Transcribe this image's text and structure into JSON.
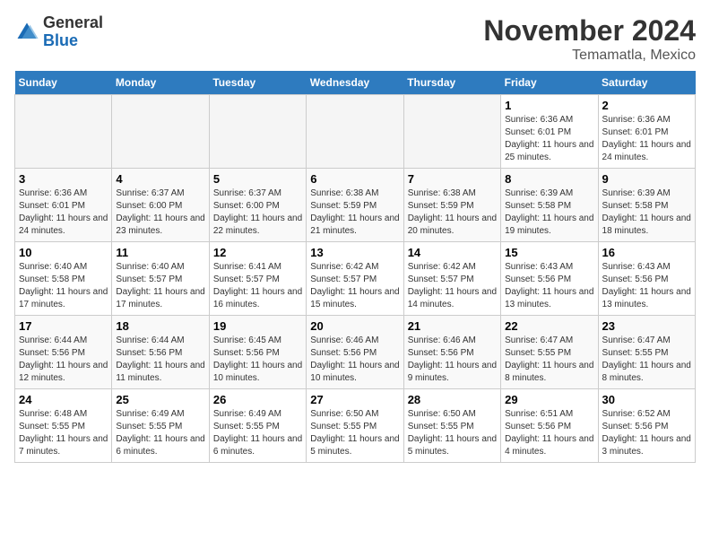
{
  "header": {
    "logo_general": "General",
    "logo_blue": "Blue",
    "month_title": "November 2024",
    "location": "Temamatla, Mexico"
  },
  "weekdays": [
    "Sunday",
    "Monday",
    "Tuesday",
    "Wednesday",
    "Thursday",
    "Friday",
    "Saturday"
  ],
  "weeks": [
    [
      {
        "day": "",
        "empty": true
      },
      {
        "day": "",
        "empty": true
      },
      {
        "day": "",
        "empty": true
      },
      {
        "day": "",
        "empty": true
      },
      {
        "day": "",
        "empty": true
      },
      {
        "day": "1",
        "sunrise": "Sunrise: 6:36 AM",
        "sunset": "Sunset: 6:01 PM",
        "daylight": "Daylight: 11 hours and 25 minutes."
      },
      {
        "day": "2",
        "sunrise": "Sunrise: 6:36 AM",
        "sunset": "Sunset: 6:01 PM",
        "daylight": "Daylight: 11 hours and 24 minutes."
      }
    ],
    [
      {
        "day": "3",
        "sunrise": "Sunrise: 6:36 AM",
        "sunset": "Sunset: 6:01 PM",
        "daylight": "Daylight: 11 hours and 24 minutes."
      },
      {
        "day": "4",
        "sunrise": "Sunrise: 6:37 AM",
        "sunset": "Sunset: 6:00 PM",
        "daylight": "Daylight: 11 hours and 23 minutes."
      },
      {
        "day": "5",
        "sunrise": "Sunrise: 6:37 AM",
        "sunset": "Sunset: 6:00 PM",
        "daylight": "Daylight: 11 hours and 22 minutes."
      },
      {
        "day": "6",
        "sunrise": "Sunrise: 6:38 AM",
        "sunset": "Sunset: 5:59 PM",
        "daylight": "Daylight: 11 hours and 21 minutes."
      },
      {
        "day": "7",
        "sunrise": "Sunrise: 6:38 AM",
        "sunset": "Sunset: 5:59 PM",
        "daylight": "Daylight: 11 hours and 20 minutes."
      },
      {
        "day": "8",
        "sunrise": "Sunrise: 6:39 AM",
        "sunset": "Sunset: 5:58 PM",
        "daylight": "Daylight: 11 hours and 19 minutes."
      },
      {
        "day": "9",
        "sunrise": "Sunrise: 6:39 AM",
        "sunset": "Sunset: 5:58 PM",
        "daylight": "Daylight: 11 hours and 18 minutes."
      }
    ],
    [
      {
        "day": "10",
        "sunrise": "Sunrise: 6:40 AM",
        "sunset": "Sunset: 5:58 PM",
        "daylight": "Daylight: 11 hours and 17 minutes."
      },
      {
        "day": "11",
        "sunrise": "Sunrise: 6:40 AM",
        "sunset": "Sunset: 5:57 PM",
        "daylight": "Daylight: 11 hours and 17 minutes."
      },
      {
        "day": "12",
        "sunrise": "Sunrise: 6:41 AM",
        "sunset": "Sunset: 5:57 PM",
        "daylight": "Daylight: 11 hours and 16 minutes."
      },
      {
        "day": "13",
        "sunrise": "Sunrise: 6:42 AM",
        "sunset": "Sunset: 5:57 PM",
        "daylight": "Daylight: 11 hours and 15 minutes."
      },
      {
        "day": "14",
        "sunrise": "Sunrise: 6:42 AM",
        "sunset": "Sunset: 5:57 PM",
        "daylight": "Daylight: 11 hours and 14 minutes."
      },
      {
        "day": "15",
        "sunrise": "Sunrise: 6:43 AM",
        "sunset": "Sunset: 5:56 PM",
        "daylight": "Daylight: 11 hours and 13 minutes."
      },
      {
        "day": "16",
        "sunrise": "Sunrise: 6:43 AM",
        "sunset": "Sunset: 5:56 PM",
        "daylight": "Daylight: 11 hours and 13 minutes."
      }
    ],
    [
      {
        "day": "17",
        "sunrise": "Sunrise: 6:44 AM",
        "sunset": "Sunset: 5:56 PM",
        "daylight": "Daylight: 11 hours and 12 minutes."
      },
      {
        "day": "18",
        "sunrise": "Sunrise: 6:44 AM",
        "sunset": "Sunset: 5:56 PM",
        "daylight": "Daylight: 11 hours and 11 minutes."
      },
      {
        "day": "19",
        "sunrise": "Sunrise: 6:45 AM",
        "sunset": "Sunset: 5:56 PM",
        "daylight": "Daylight: 11 hours and 10 minutes."
      },
      {
        "day": "20",
        "sunrise": "Sunrise: 6:46 AM",
        "sunset": "Sunset: 5:56 PM",
        "daylight": "Daylight: 11 hours and 10 minutes."
      },
      {
        "day": "21",
        "sunrise": "Sunrise: 6:46 AM",
        "sunset": "Sunset: 5:56 PM",
        "daylight": "Daylight: 11 hours and 9 minutes."
      },
      {
        "day": "22",
        "sunrise": "Sunrise: 6:47 AM",
        "sunset": "Sunset: 5:55 PM",
        "daylight": "Daylight: 11 hours and 8 minutes."
      },
      {
        "day": "23",
        "sunrise": "Sunrise: 6:47 AM",
        "sunset": "Sunset: 5:55 PM",
        "daylight": "Daylight: 11 hours and 8 minutes."
      }
    ],
    [
      {
        "day": "24",
        "sunrise": "Sunrise: 6:48 AM",
        "sunset": "Sunset: 5:55 PM",
        "daylight": "Daylight: 11 hours and 7 minutes."
      },
      {
        "day": "25",
        "sunrise": "Sunrise: 6:49 AM",
        "sunset": "Sunset: 5:55 PM",
        "daylight": "Daylight: 11 hours and 6 minutes."
      },
      {
        "day": "26",
        "sunrise": "Sunrise: 6:49 AM",
        "sunset": "Sunset: 5:55 PM",
        "daylight": "Daylight: 11 hours and 6 minutes."
      },
      {
        "day": "27",
        "sunrise": "Sunrise: 6:50 AM",
        "sunset": "Sunset: 5:55 PM",
        "daylight": "Daylight: 11 hours and 5 minutes."
      },
      {
        "day": "28",
        "sunrise": "Sunrise: 6:50 AM",
        "sunset": "Sunset: 5:55 PM",
        "daylight": "Daylight: 11 hours and 5 minutes."
      },
      {
        "day": "29",
        "sunrise": "Sunrise: 6:51 AM",
        "sunset": "Sunset: 5:56 PM",
        "daylight": "Daylight: 11 hours and 4 minutes."
      },
      {
        "day": "30",
        "sunrise": "Sunrise: 6:52 AM",
        "sunset": "Sunset: 5:56 PM",
        "daylight": "Daylight: 11 hours and 3 minutes."
      }
    ]
  ]
}
